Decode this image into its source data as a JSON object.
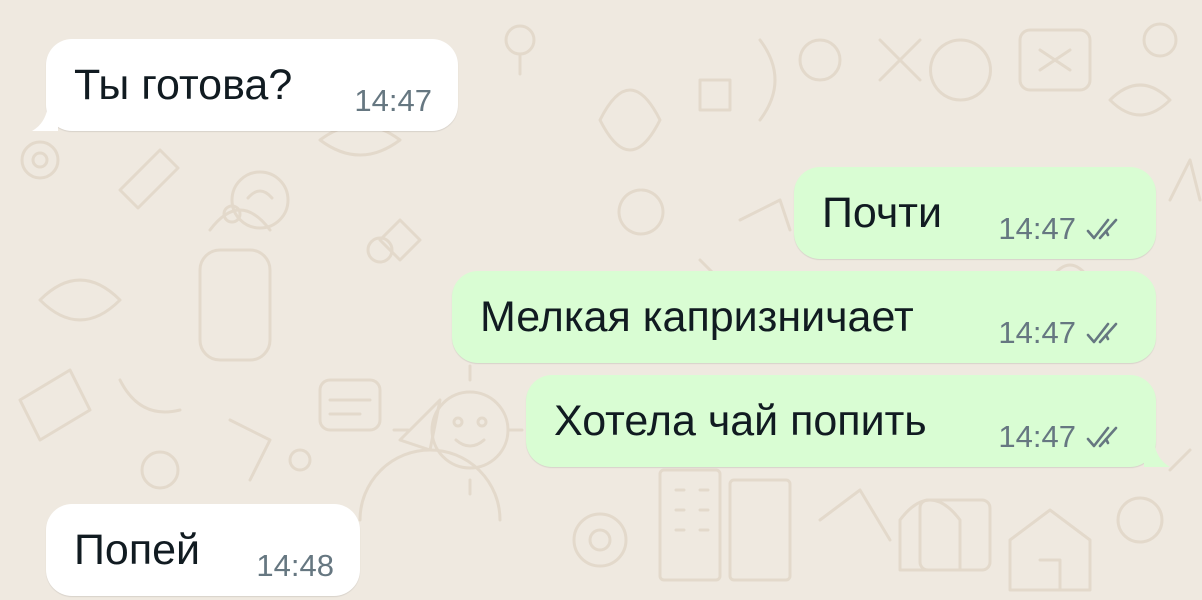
{
  "theme": {
    "wallpaper_color": "#efe9e0",
    "doodle_color": "#e3d9cb",
    "incoming_bubble_color": "#ffffff",
    "outgoing_bubble_color": "#d9fdd3",
    "text_color": "#111b21",
    "time_color": "#667781",
    "tick_color": "#667781"
  },
  "messages": [
    {
      "direction": "incoming",
      "text": "Ты готова?",
      "time": "14:47"
    },
    {
      "direction": "outgoing",
      "text": "Почти",
      "time": "14:47",
      "status_icon": "double-check-icon"
    },
    {
      "direction": "outgoing",
      "text": "Мелкая капризничает",
      "time": "14:47",
      "status_icon": "double-check-icon"
    },
    {
      "direction": "outgoing",
      "text": "Хотела чай попить",
      "time": "14:47",
      "status_icon": "double-check-icon"
    },
    {
      "direction": "incoming",
      "text": "Попей",
      "time": "14:48"
    }
  ]
}
